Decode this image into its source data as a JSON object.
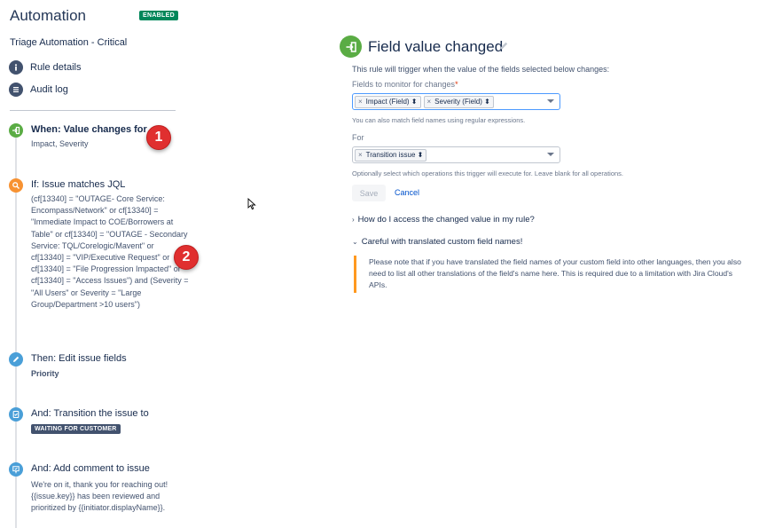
{
  "header": {
    "app_title": "Automation",
    "status_badge": "ENABLED",
    "rule_name": "Triage Automation - Critical"
  },
  "nav": {
    "rule_details": "Rule details",
    "audit_log": "Audit log"
  },
  "steps": {
    "trigger": {
      "title": "When: Value changes for",
      "body": "Impact, Severity"
    },
    "condition": {
      "title": "If: Issue matches JQL",
      "body": "(cf[13340] = \"OUTAGE- Core Service: Encompass/Network\" or cf[13340] = \"Immediate Impact to COE/Borrowers at Table\" or cf[13340] = \"OUTAGE - Secondary Service: TQL/Corelogic/Mavent\" or cf[13340] = \"VIP/Executive Request\" or cf[13340] = \"File Progression Impacted\" or cf[13340] = \"Access Issues\") and (Severity = \"All Users\" or Severity = \"Large Group/Department >10 users\")"
    },
    "edit": {
      "title": "Then: Edit issue fields",
      "body": "Priority"
    },
    "transition": {
      "title": "And: Transition the issue to",
      "status": "WAITING FOR CUSTOMER"
    },
    "comment": {
      "title": "And: Add comment to issue",
      "body": "We're on it, thank you for reaching out! {{issue.key}} has been reviewed and prioritized by {{initiator.displayName}}."
    }
  },
  "callouts": {
    "one": "1",
    "two": "2"
  },
  "panel": {
    "title": "Field value changed",
    "intro": "This rule will trigger when the value of the fields selected below changes:",
    "fields_label": "Fields to monitor for changes",
    "required_mark": "*",
    "fields_tags": {
      "impact": "Impact (Field) ⬍",
      "severity": "Severity (Field) ⬍"
    },
    "fields_help": "You can also match field names using regular expressions.",
    "for_label": "For",
    "for_tag": "Transition issue ⬍",
    "for_help": "Optionally select which operations this trigger will execute for. Leave blank for all operations.",
    "save_label": "Save",
    "cancel_label": "Cancel",
    "faq_label": "How do I access the changed value in my rule?",
    "warning_label": "Careful with translated custom field names!",
    "warning_text": "Please note that if you have translated the field names of your custom field into other languages, then you also need to list all other translations of the field's name here. This is required due to a limitation with Jira Cloud's APIs."
  },
  "colors": {
    "enabled": "#00875a",
    "trigger": "#5aac44",
    "condition": "#f79232",
    "action": "#4a9fd8",
    "callout": "#e02f2f",
    "warning_border": "#ff991f",
    "link": "#0052cc"
  },
  "icons": {
    "rule_details": "info-circle-icon",
    "audit_log": "list-icon",
    "trigger": "enter-arrow-icon",
    "condition": "search-icon",
    "edit": "pencil-icon",
    "transition": "document-icon",
    "comment": "comment-icon"
  }
}
